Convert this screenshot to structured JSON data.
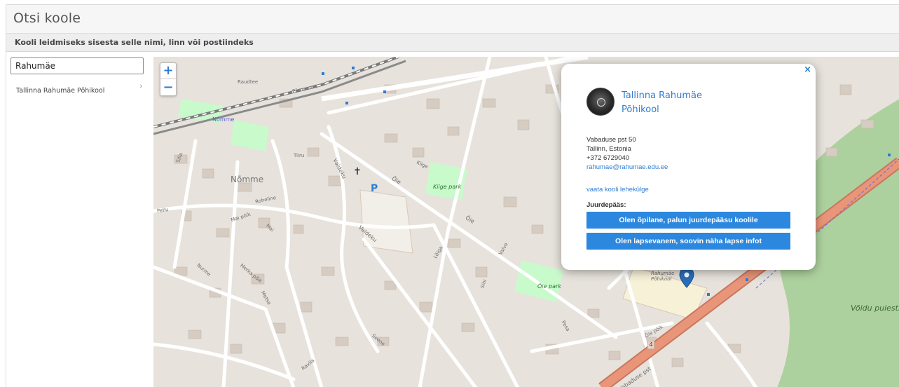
{
  "header": {
    "title": "Otsi koole"
  },
  "instructions": "Kooli leidmiseks sisesta selle nimi, linn või postiindeks",
  "search": {
    "value": "Rahumäe"
  },
  "results": [
    {
      "label": "Tallinna Rahumäe Põhikool"
    }
  ],
  "map": {
    "zoom_in": "+",
    "zoom_out": "−",
    "labels": {
      "nomme_area": "Nõmme",
      "nomme_station": "Nõmme",
      "kiige_park": "Kiige park",
      "oie_park": "Õie park",
      "voidu_puiestik": "Võidu puiestik",
      "raudtee": "Raudtee",
      "parnu_mnt": "Pärnu mnt",
      "oie": "Õie",
      "valdeku": "Valdeku",
      "vabaduse_pst": "Vabaduse pst",
      "roheline": "Roheline",
      "mai": "Mai",
      "mai_pik": "Mai põik",
      "nurme": "Nurme",
      "merka_poik": "Merka põik",
      "metsa": "Metsa",
      "seene": "Seene",
      "ravila": "Ravila",
      "kiige": "Kiige",
      "tiiru": "Tiiru",
      "silla": "Silla",
      "pellu": "Pellu",
      "loiga": "Lõiga",
      "valve": "Valve",
      "sihi": "Sihi",
      "pesa": "Pesa",
      "oie_poik": "Õie põik",
      "rahumae_label": "Rahumäe Põhikool",
      "route_number": "4",
      "parking": "P"
    }
  },
  "popup": {
    "close": "×",
    "school_name": "Tallinna Rahumäe Põhikool",
    "address": "Vabaduse pst 50",
    "city": "Tallinn, Estonia",
    "phone": "+372 6729040",
    "email": "rahumae@rahumae.edu.ee",
    "website_link": "vaata kooli lehekülge",
    "access_label": "Juurdepääs:",
    "student_button": "Olen õpilane, palun juurdepääsu koolile",
    "parent_button": "Olen lapsevanem, soovin näha lapse infot"
  },
  "colors": {
    "accent": "#2c87de",
    "link": "#2e7dd1",
    "main_road": "#e8957a",
    "forest": "#add19e",
    "park": "#c8facc"
  }
}
